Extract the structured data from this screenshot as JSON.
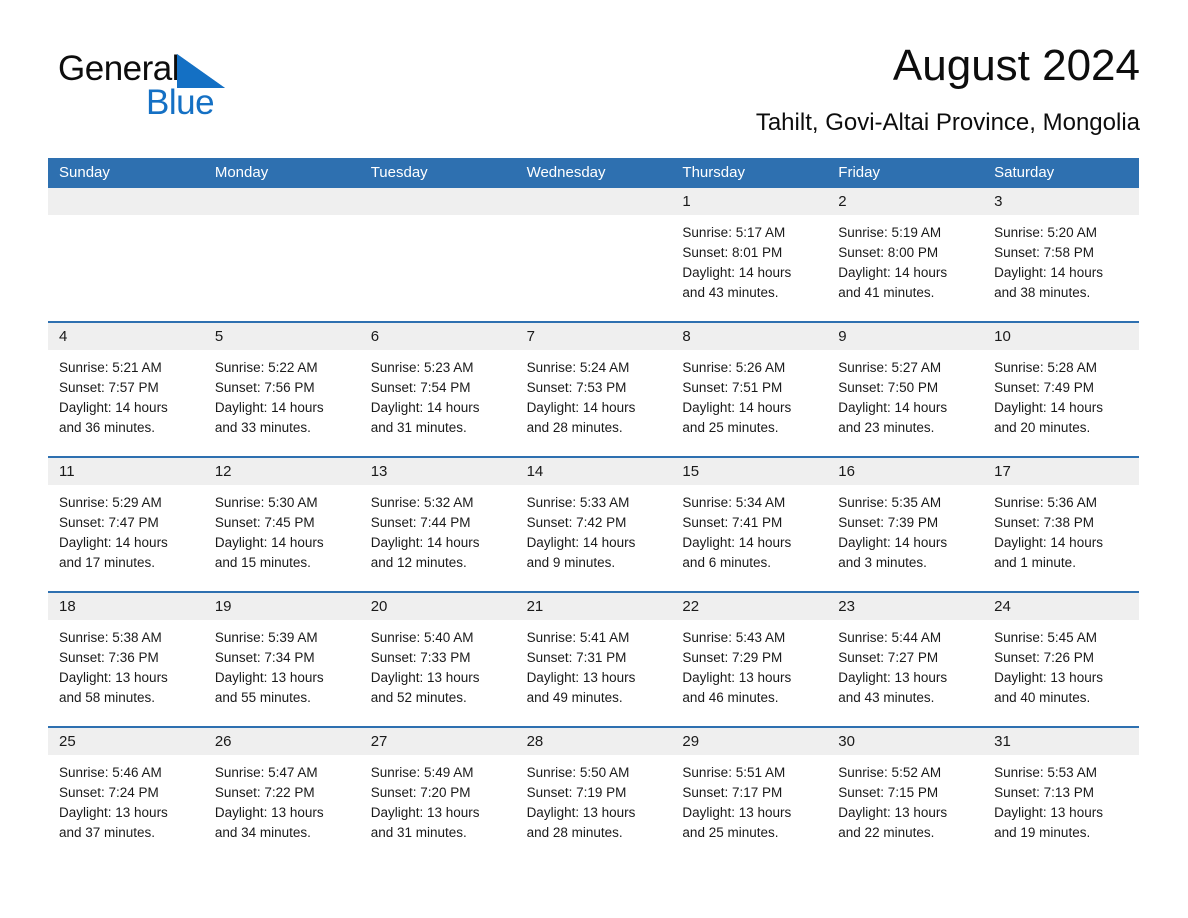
{
  "logo": {
    "word_general": "General",
    "word_blue": "Blue",
    "triangle_color": "#1470c4",
    "general_color": "#0d0d0d"
  },
  "header": {
    "month_title": "August 2024",
    "location": "Tahilt, Govi-Altai Province, Mongolia"
  },
  "theme": {
    "header_blue": "#2e70b0",
    "date_band_gray": "#efefef",
    "text_color": "#1a1a1a",
    "page_background": "#ffffff"
  },
  "calendar": {
    "weekdays": [
      "Sunday",
      "Monday",
      "Tuesday",
      "Wednesday",
      "Thursday",
      "Friday",
      "Saturday"
    ],
    "weeks": [
      [
        {
          "day": "",
          "sunrise": "",
          "sunset": "",
          "daylight_line1": "",
          "daylight_line2": ""
        },
        {
          "day": "",
          "sunrise": "",
          "sunset": "",
          "daylight_line1": "",
          "daylight_line2": ""
        },
        {
          "day": "",
          "sunrise": "",
          "sunset": "",
          "daylight_line1": "",
          "daylight_line2": ""
        },
        {
          "day": "",
          "sunrise": "",
          "sunset": "",
          "daylight_line1": "",
          "daylight_line2": ""
        },
        {
          "day": "1",
          "sunrise": "Sunrise: 5:17 AM",
          "sunset": "Sunset: 8:01 PM",
          "daylight_line1": "Daylight: 14 hours",
          "daylight_line2": "and 43 minutes."
        },
        {
          "day": "2",
          "sunrise": "Sunrise: 5:19 AM",
          "sunset": "Sunset: 8:00 PM",
          "daylight_line1": "Daylight: 14 hours",
          "daylight_line2": "and 41 minutes."
        },
        {
          "day": "3",
          "sunrise": "Sunrise: 5:20 AM",
          "sunset": "Sunset: 7:58 PM",
          "daylight_line1": "Daylight: 14 hours",
          "daylight_line2": "and 38 minutes."
        }
      ],
      [
        {
          "day": "4",
          "sunrise": "Sunrise: 5:21 AM",
          "sunset": "Sunset: 7:57 PM",
          "daylight_line1": "Daylight: 14 hours",
          "daylight_line2": "and 36 minutes."
        },
        {
          "day": "5",
          "sunrise": "Sunrise: 5:22 AM",
          "sunset": "Sunset: 7:56 PM",
          "daylight_line1": "Daylight: 14 hours",
          "daylight_line2": "and 33 minutes."
        },
        {
          "day": "6",
          "sunrise": "Sunrise: 5:23 AM",
          "sunset": "Sunset: 7:54 PM",
          "daylight_line1": "Daylight: 14 hours",
          "daylight_line2": "and 31 minutes."
        },
        {
          "day": "7",
          "sunrise": "Sunrise: 5:24 AM",
          "sunset": "Sunset: 7:53 PM",
          "daylight_line1": "Daylight: 14 hours",
          "daylight_line2": "and 28 minutes."
        },
        {
          "day": "8",
          "sunrise": "Sunrise: 5:26 AM",
          "sunset": "Sunset: 7:51 PM",
          "daylight_line1": "Daylight: 14 hours",
          "daylight_line2": "and 25 minutes."
        },
        {
          "day": "9",
          "sunrise": "Sunrise: 5:27 AM",
          "sunset": "Sunset: 7:50 PM",
          "daylight_line1": "Daylight: 14 hours",
          "daylight_line2": "and 23 minutes."
        },
        {
          "day": "10",
          "sunrise": "Sunrise: 5:28 AM",
          "sunset": "Sunset: 7:49 PM",
          "daylight_line1": "Daylight: 14 hours",
          "daylight_line2": "and 20 minutes."
        }
      ],
      [
        {
          "day": "11",
          "sunrise": "Sunrise: 5:29 AM",
          "sunset": "Sunset: 7:47 PM",
          "daylight_line1": "Daylight: 14 hours",
          "daylight_line2": "and 17 minutes."
        },
        {
          "day": "12",
          "sunrise": "Sunrise: 5:30 AM",
          "sunset": "Sunset: 7:45 PM",
          "daylight_line1": "Daylight: 14 hours",
          "daylight_line2": "and 15 minutes."
        },
        {
          "day": "13",
          "sunrise": "Sunrise: 5:32 AM",
          "sunset": "Sunset: 7:44 PM",
          "daylight_line1": "Daylight: 14 hours",
          "daylight_line2": "and 12 minutes."
        },
        {
          "day": "14",
          "sunrise": "Sunrise: 5:33 AM",
          "sunset": "Sunset: 7:42 PM",
          "daylight_line1": "Daylight: 14 hours",
          "daylight_line2": "and 9 minutes."
        },
        {
          "day": "15",
          "sunrise": "Sunrise: 5:34 AM",
          "sunset": "Sunset: 7:41 PM",
          "daylight_line1": "Daylight: 14 hours",
          "daylight_line2": "and 6 minutes."
        },
        {
          "day": "16",
          "sunrise": "Sunrise: 5:35 AM",
          "sunset": "Sunset: 7:39 PM",
          "daylight_line1": "Daylight: 14 hours",
          "daylight_line2": "and 3 minutes."
        },
        {
          "day": "17",
          "sunrise": "Sunrise: 5:36 AM",
          "sunset": "Sunset: 7:38 PM",
          "daylight_line1": "Daylight: 14 hours",
          "daylight_line2": "and 1 minute."
        }
      ],
      [
        {
          "day": "18",
          "sunrise": "Sunrise: 5:38 AM",
          "sunset": "Sunset: 7:36 PM",
          "daylight_line1": "Daylight: 13 hours",
          "daylight_line2": "and 58 minutes."
        },
        {
          "day": "19",
          "sunrise": "Sunrise: 5:39 AM",
          "sunset": "Sunset: 7:34 PM",
          "daylight_line1": "Daylight: 13 hours",
          "daylight_line2": "and 55 minutes."
        },
        {
          "day": "20",
          "sunrise": "Sunrise: 5:40 AM",
          "sunset": "Sunset: 7:33 PM",
          "daylight_line1": "Daylight: 13 hours",
          "daylight_line2": "and 52 minutes."
        },
        {
          "day": "21",
          "sunrise": "Sunrise: 5:41 AM",
          "sunset": "Sunset: 7:31 PM",
          "daylight_line1": "Daylight: 13 hours",
          "daylight_line2": "and 49 minutes."
        },
        {
          "day": "22",
          "sunrise": "Sunrise: 5:43 AM",
          "sunset": "Sunset: 7:29 PM",
          "daylight_line1": "Daylight: 13 hours",
          "daylight_line2": "and 46 minutes."
        },
        {
          "day": "23",
          "sunrise": "Sunrise: 5:44 AM",
          "sunset": "Sunset: 7:27 PM",
          "daylight_line1": "Daylight: 13 hours",
          "daylight_line2": "and 43 minutes."
        },
        {
          "day": "24",
          "sunrise": "Sunrise: 5:45 AM",
          "sunset": "Sunset: 7:26 PM",
          "daylight_line1": "Daylight: 13 hours",
          "daylight_line2": "and 40 minutes."
        }
      ],
      [
        {
          "day": "25",
          "sunrise": "Sunrise: 5:46 AM",
          "sunset": "Sunset: 7:24 PM",
          "daylight_line1": "Daylight: 13 hours",
          "daylight_line2": "and 37 minutes."
        },
        {
          "day": "26",
          "sunrise": "Sunrise: 5:47 AM",
          "sunset": "Sunset: 7:22 PM",
          "daylight_line1": "Daylight: 13 hours",
          "daylight_line2": "and 34 minutes."
        },
        {
          "day": "27",
          "sunrise": "Sunrise: 5:49 AM",
          "sunset": "Sunset: 7:20 PM",
          "daylight_line1": "Daylight: 13 hours",
          "daylight_line2": "and 31 minutes."
        },
        {
          "day": "28",
          "sunrise": "Sunrise: 5:50 AM",
          "sunset": "Sunset: 7:19 PM",
          "daylight_line1": "Daylight: 13 hours",
          "daylight_line2": "and 28 minutes."
        },
        {
          "day": "29",
          "sunrise": "Sunrise: 5:51 AM",
          "sunset": "Sunset: 7:17 PM",
          "daylight_line1": "Daylight: 13 hours",
          "daylight_line2": "and 25 minutes."
        },
        {
          "day": "30",
          "sunrise": "Sunrise: 5:52 AM",
          "sunset": "Sunset: 7:15 PM",
          "daylight_line1": "Daylight: 13 hours",
          "daylight_line2": "and 22 minutes."
        },
        {
          "day": "31",
          "sunrise": "Sunrise: 5:53 AM",
          "sunset": "Sunset: 7:13 PM",
          "daylight_line1": "Daylight: 13 hours",
          "daylight_line2": "and 19 minutes."
        }
      ]
    ]
  }
}
